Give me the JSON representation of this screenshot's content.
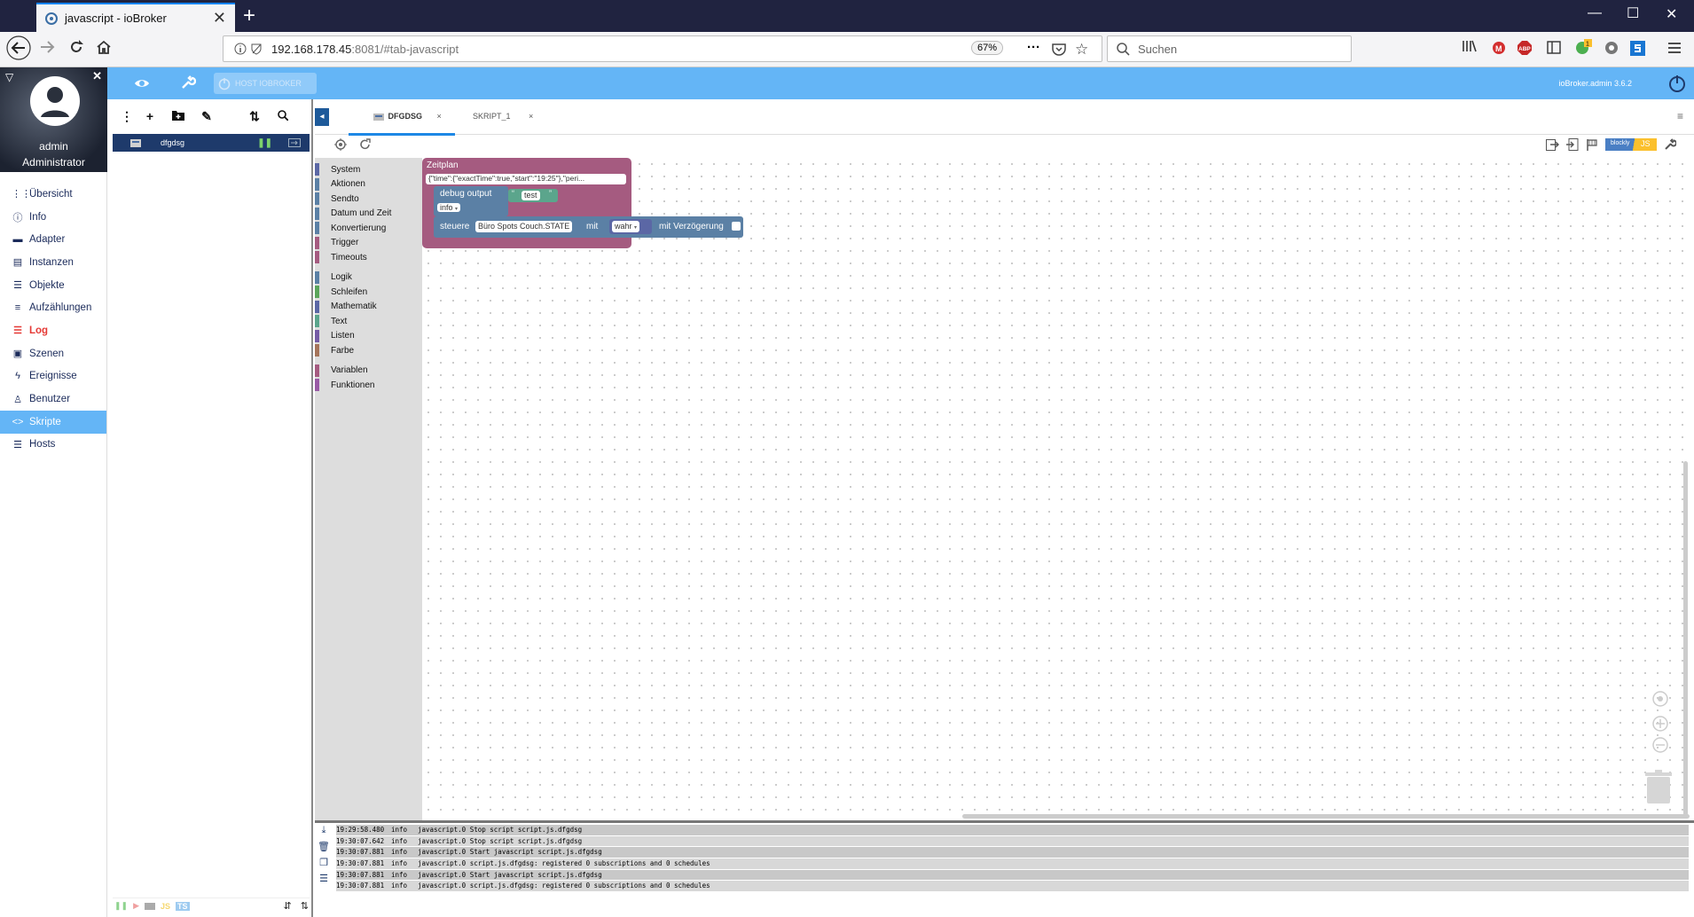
{
  "browser": {
    "tab_title": "javascript - ioBroker",
    "new_tab": "+",
    "tab_close": "✕",
    "url_host": "192.168.178.45",
    "url_rest": ":8081/#tab-javascript",
    "zoom": "67%",
    "search_placeholder": "Suchen"
  },
  "app": {
    "host_button": "HOST IOBROKER",
    "version": "ioBroker.admin 3.6.2"
  },
  "user": {
    "name": "admin",
    "role": "Administrator"
  },
  "sidebar": {
    "items": [
      {
        "label": "Übersicht",
        "icon": "grid-icon"
      },
      {
        "label": "Info",
        "icon": "info-icon"
      },
      {
        "label": "Adapter",
        "icon": "store-icon"
      },
      {
        "label": "Instanzen",
        "icon": "instances-icon"
      },
      {
        "label": "Objekte",
        "icon": "list-icon"
      },
      {
        "label": "Aufzählungen",
        "icon": "enum-icon"
      },
      {
        "label": "Log",
        "icon": "log-icon"
      },
      {
        "label": "Szenen",
        "icon": "scenes-icon"
      },
      {
        "label": "Ereignisse",
        "icon": "bolt-icon"
      },
      {
        "label": "Benutzer",
        "icon": "user-icon"
      },
      {
        "label": "Skripte",
        "icon": "code-icon"
      },
      {
        "label": "Hosts",
        "icon": "hosts-icon"
      }
    ],
    "active": "Skripte"
  },
  "scripts": {
    "selected_name": "dfgdsg"
  },
  "editor": {
    "tabs": [
      {
        "label": "DFGDSG",
        "active": true
      },
      {
        "label": "SKRIPT_1",
        "active": false
      }
    ],
    "tab_close": "×",
    "mode_blockly": "blockly",
    "mode_js": "JS"
  },
  "toolbox": {
    "group1": [
      {
        "label": "System",
        "color": "#5b67a5"
      },
      {
        "label": "Aktionen",
        "color": "#5b80a5"
      },
      {
        "label": "Sendto",
        "color": "#5b80a5"
      },
      {
        "label": "Datum und Zeit",
        "color": "#5b80a5"
      },
      {
        "label": "Konvertierung",
        "color": "#5b80a5"
      },
      {
        "label": "Trigger",
        "color": "#a55b80"
      },
      {
        "label": "Timeouts",
        "color": "#a55b80"
      }
    ],
    "group2": [
      {
        "label": "Logik",
        "color": "#5b80a5"
      },
      {
        "label": "Schleifen",
        "color": "#5ba55b"
      },
      {
        "label": "Mathematik",
        "color": "#5b67a5"
      },
      {
        "label": "Text",
        "color": "#5ba58c"
      },
      {
        "label": "Listen",
        "color": "#745ba5"
      },
      {
        "label": "Farbe",
        "color": "#a5745b"
      }
    ],
    "group3": [
      {
        "label": "Variablen",
        "color": "#a55b80"
      },
      {
        "label": "Funktionen",
        "color": "#995ba5"
      }
    ]
  },
  "blocks": {
    "schedule_title": "Zeitplan",
    "schedule_value": "{\"time\":{\"exactTime\":true,\"start\":\"19:25\"},\"peri...",
    "debug_label": "debug output",
    "debug_text": "test",
    "debug_level": "info",
    "control_label": "steuere",
    "control_object": "Büro Spots Couch.STATE",
    "control_with": "mit",
    "control_value": "wahr",
    "control_delay": "mit Verzögerung"
  },
  "log": [
    {
      "time": "19:29:58.480",
      "level": "info",
      "message": "javascript.0 Stop script script.js.dfgdsg"
    },
    {
      "time": "19:30:07.642",
      "level": "info",
      "message": "javascript.0 Stop script script.js.dfgdsg"
    },
    {
      "time": "19:30:07.881",
      "level": "info",
      "message": "javascript.0 Start javascript script.js.dfgdsg"
    },
    {
      "time": "19:30:07.881",
      "level": "info",
      "message": "javascript.0 script.js.dfgdsg: registered 0 subscriptions and 0 schedules"
    },
    {
      "time": "19:30:07.881",
      "level": "info",
      "message": "javascript.0 Start javascript script.js.dfgdsg"
    },
    {
      "time": "19:30:07.881",
      "level": "info",
      "message": "javascript.0 script.js.dfgdsg: registered 0 subscriptions and 0 schedules"
    }
  ]
}
